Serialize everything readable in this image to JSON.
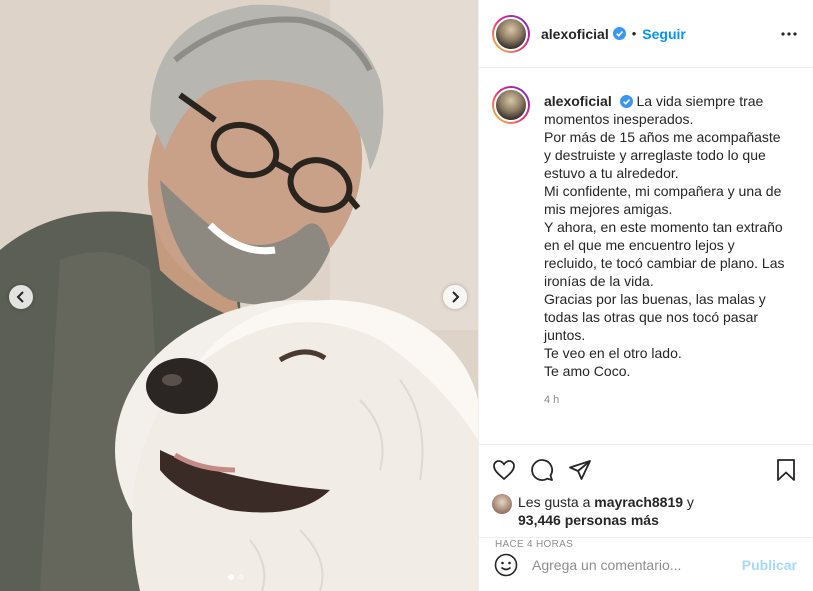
{
  "post": {
    "username": "alexoficial",
    "separator": "•",
    "follow_label": "Seguir",
    "caption_lines": [
      "La vida siempre trae",
      "momentos inesperados.",
      "Por más de 15 años me acompañaste",
      "y destruiste y arreglaste todo lo que",
      "estuvo a tu alrededor.",
      "Mi confidente, mi compañera y una de",
      "mis mejores amigas.",
      "Y ahora, en este momento tan extraño",
      "en el que me encuentro lejos y",
      "recluido, te tocó cambiar de plano. Las",
      "ironías de la vida.",
      "Gracias por las buenas, las malas y",
      "todas las otras que nos tocó pasar",
      "juntos.",
      "Te veo en el otro lado.",
      "Te amo Coco."
    ],
    "caption_time": "4 h",
    "likes_prefix": "Les gusta a",
    "likes_user": "mayrach8819",
    "likes_and": "y",
    "likes_count": "93,446 personas más",
    "posted_ago": "HACE 4 HORAS",
    "comment_placeholder": "Agrega un comentario...",
    "publish_label": "Publicar",
    "carousel": {
      "total": 2,
      "active": 1
    }
  },
  "icons": {
    "verified": "verified-badge-icon",
    "more": "more-options-icon",
    "like": "heart-icon",
    "comment": "comment-icon",
    "share": "share-icon",
    "save": "bookmark-icon",
    "emoji": "emoji-icon",
    "prev": "chevron-left-icon",
    "next": "chevron-right-icon"
  },
  "colors": {
    "accent": "#0095f6",
    "text": "#262626",
    "muted": "#8e8e8e",
    "border": "#efefef"
  }
}
